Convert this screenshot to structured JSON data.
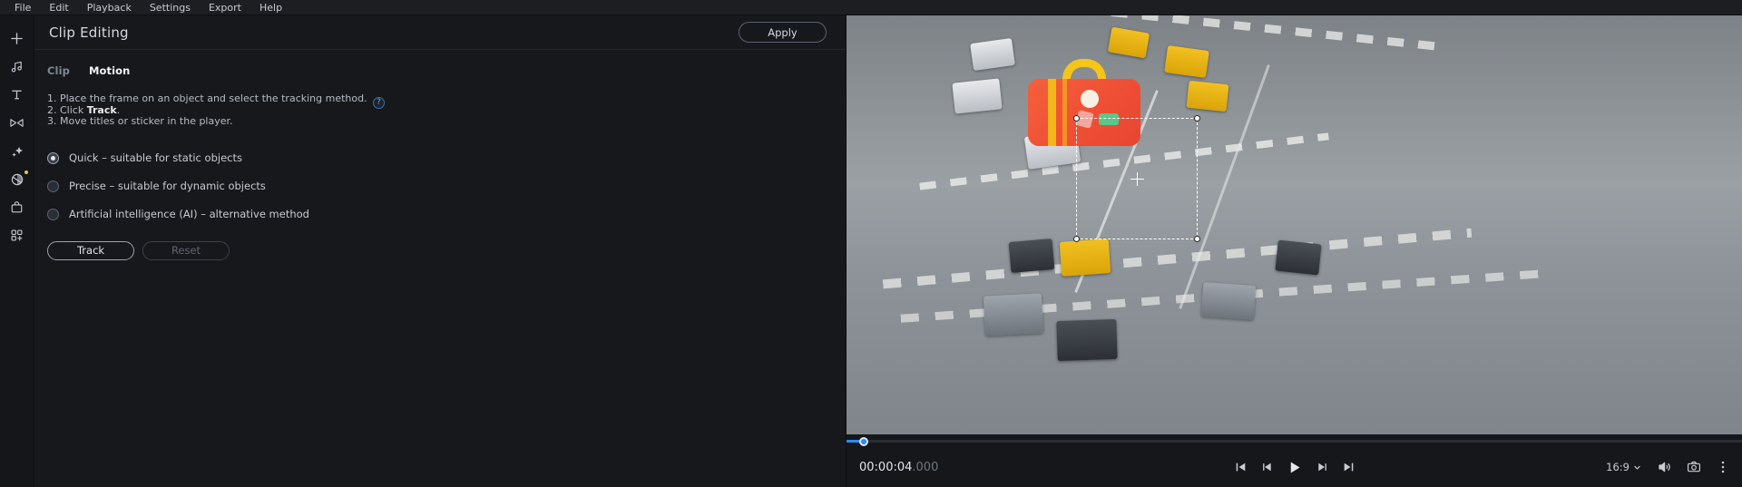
{
  "menubar": {
    "items": [
      {
        "label": "File"
      },
      {
        "label": "Edit"
      },
      {
        "label": "Playback"
      },
      {
        "label": "Settings"
      },
      {
        "label": "Export"
      },
      {
        "label": "Help"
      }
    ]
  },
  "rail": {
    "items": [
      {
        "name": "add-media-icon"
      },
      {
        "name": "audio-music-icon"
      },
      {
        "name": "titles-text-icon"
      },
      {
        "name": "transitions-icon"
      },
      {
        "name": "effects-sparkle-icon"
      },
      {
        "name": "filters-icon",
        "badge": true
      },
      {
        "name": "stickers-icon"
      },
      {
        "name": "more-tools-grid-icon"
      }
    ]
  },
  "panel": {
    "title": "Clip Editing",
    "apply_label": "Apply",
    "tabs": [
      {
        "label": "Clip",
        "active": false
      },
      {
        "label": "Motion",
        "active": true
      }
    ],
    "instructions": {
      "line1_prefix": "1. Place the frame on an object and select the tracking method.",
      "line2_prefix": "2. Click ",
      "line2_bold": "Track",
      "line2_suffix": ".",
      "line3": "3. Move titles or sticker in the player.",
      "help_glyph": "?"
    },
    "tracking_methods": [
      {
        "label": "Quick – suitable for static objects",
        "selected": true
      },
      {
        "label": "Precise – suitable for dynamic objects",
        "selected": false
      },
      {
        "label": "Artificial intelligence (AI) – alternative method",
        "selected": false
      }
    ],
    "buttons": {
      "track_label": "Track",
      "reset_label": "Reset"
    }
  },
  "player": {
    "timecode_main": "00:00:04",
    "timecode_ms": ".000",
    "aspect_ratio": "16:9",
    "scrubber_percent": 3,
    "transport": [
      {
        "name": "jump-to-start-button"
      },
      {
        "name": "step-back-button"
      },
      {
        "name": "play-button"
      },
      {
        "name": "step-forward-button"
      },
      {
        "name": "jump-to-end-button"
      }
    ],
    "right_controls": [
      {
        "name": "aspect-ratio-selector"
      },
      {
        "name": "volume-icon"
      },
      {
        "name": "snapshot-camera-icon"
      },
      {
        "name": "more-options-icon"
      }
    ]
  },
  "colors": {
    "accent_blue": "#2a8cf0",
    "panel_bg": "#16181c",
    "menu_bg": "#1c1e22",
    "rail_bg": "#141619",
    "badge_yellow": "#e8c34a"
  }
}
